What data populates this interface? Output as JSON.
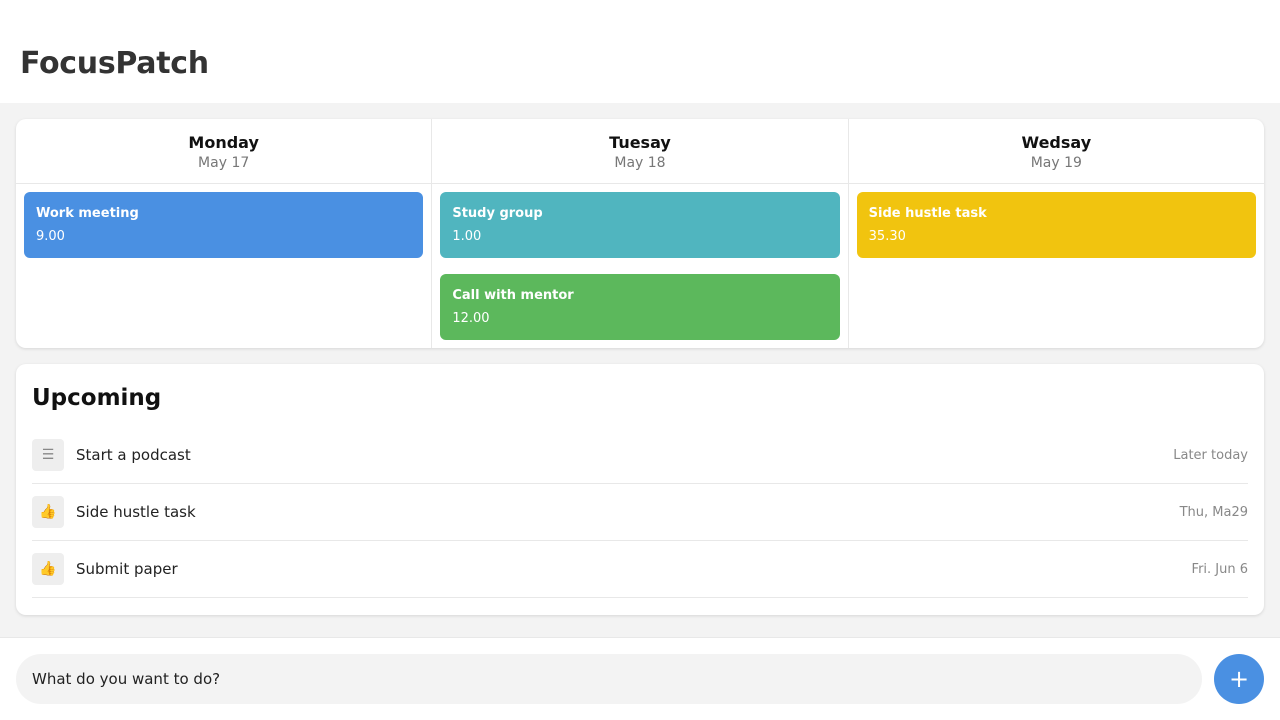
{
  "app": {
    "title": "FocusPatch"
  },
  "calendar": {
    "days": [
      {
        "name": "Monday",
        "date": "May 17",
        "events": [
          {
            "title": "Work meeting",
            "time": "9.00",
            "color": "#4a90e2"
          }
        ]
      },
      {
        "name": "Tuesay",
        "date": "May 18",
        "events": [
          {
            "title": "Study group",
            "time": "1.00",
            "color": "#50b5bf"
          },
          {
            "title": "Call with mentor",
            "time": "12.00",
            "color": "#5cb85c"
          }
        ]
      },
      {
        "name": "Wedsay",
        "date": "May 19",
        "events": [
          {
            "title": "Side hustle task",
            "time": "35.30",
            "color": "#f1c40f"
          }
        ]
      }
    ]
  },
  "upcoming": {
    "title": "Upcoming",
    "items": [
      {
        "icon": "list-icon",
        "glyph": "☰",
        "label": "Start a podcast",
        "when": "Later today"
      },
      {
        "icon": "thumbs-up-icon",
        "glyph": "👍",
        "label": "Side hustle task",
        "when": "Thu, Ma29"
      },
      {
        "icon": "thumbs-up-icon",
        "glyph": "👍",
        "label": "Submit paper",
        "when": "Fri. Jun 6"
      }
    ]
  },
  "composer": {
    "placeholder": "What do you want to do?",
    "add_label": "+"
  }
}
